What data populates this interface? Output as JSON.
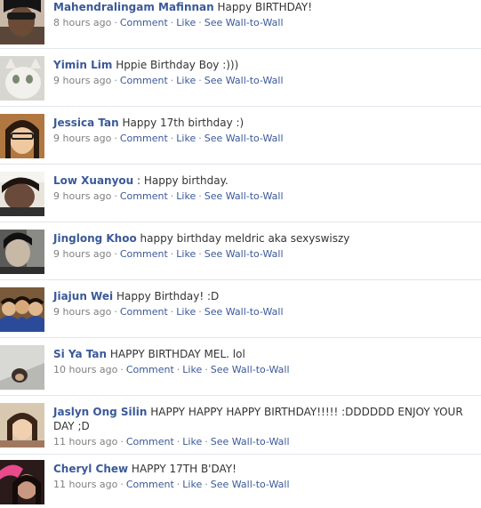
{
  "actions": {
    "comment": "Comment",
    "like": "Like",
    "wall": "See Wall-to-Wall",
    "separator": "·"
  },
  "posts": [
    {
      "name": "Mahendralingam Mafinnan",
      "message": "Happy BIRTHDAY!",
      "time": "8 hours ago",
      "avatar_icon": "profile-photo"
    },
    {
      "name": "Yimin Lim",
      "message": "Hppie Birthday Boy :)))",
      "time": "9 hours ago",
      "avatar_icon": "profile-photo"
    },
    {
      "name": "Jessica Tan",
      "message": "Happy 17th birthday :)",
      "time": "9 hours ago",
      "avatar_icon": "profile-photo"
    },
    {
      "name": "Low Xuanyou",
      "message": ": Happy birthday.",
      "time": "9 hours ago",
      "avatar_icon": "profile-photo"
    },
    {
      "name": "Jinglong Khoo",
      "message": "happy birthday meldric aka sexyswiszy",
      "time": "9 hours ago",
      "avatar_icon": "profile-photo"
    },
    {
      "name": "Jiajun Wei",
      "message": "Happy Birthday! :D",
      "time": "9 hours ago",
      "avatar_icon": "profile-photo"
    },
    {
      "name": "Si Ya Tan",
      "message": "HAPPY BIRTHDAY MEL. lol",
      "time": "10 hours ago",
      "avatar_icon": "profile-photo"
    },
    {
      "name": "Jaslyn Ong Silin",
      "message": "HAPPY HAPPY HAPPY BIRTHDAY!!!!! :DDDDDD ENJOY YOUR DAY ;D",
      "time": "11 hours ago",
      "avatar_icon": "profile-photo"
    },
    {
      "name": "Cheryl Chew",
      "message": "HAPPY 17TH B'DAY!",
      "time": "11 hours ago",
      "avatar_icon": "profile-photo"
    }
  ]
}
